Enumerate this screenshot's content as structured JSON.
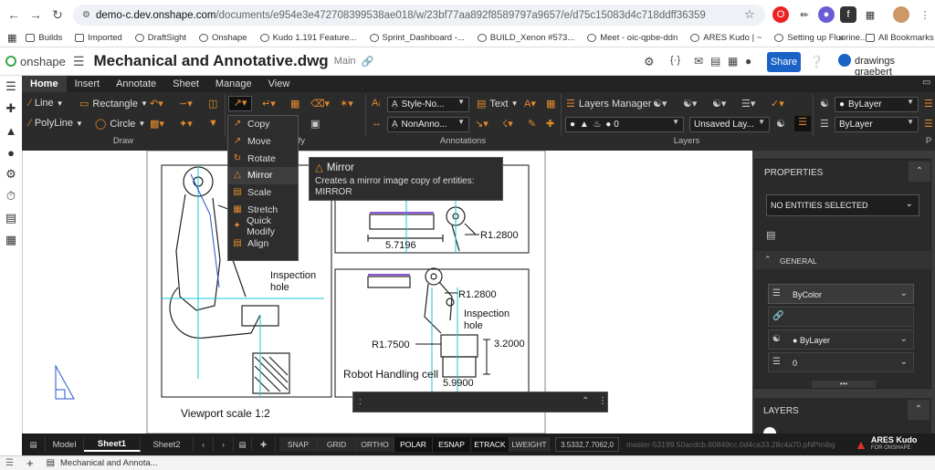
{
  "browser": {
    "url_host": "demo-c.dev.onshape.com",
    "url_path": "/documents/e954e3e472708399538ae018/w/23bf77aa892f8589797a9657/e/d75c15083d4c718ddff36359",
    "bookmarks": [
      "Builds",
      "Imported",
      "DraftSight",
      "Onshape",
      "Kudo 1.191 Feature...",
      "Sprint_Dashboard -...",
      "BUILD_Xenon #573...",
      "Meet - oic-qpbe-ddn",
      "ARES Kudo | ~",
      "Setting up Fluorine..."
    ],
    "all_bookmarks": "All Bookmarks"
  },
  "header": {
    "logo": "onshape",
    "title": "Mechanical and Annotative.dwg",
    "branch": "Main",
    "share_label": "Share",
    "user": "drawings graebert"
  },
  "ribbon": {
    "tabs": [
      "Home",
      "Insert",
      "Annotate",
      "Sheet",
      "Manage",
      "View"
    ],
    "active_tab": "Home",
    "groups": {
      "draw": "Draw",
      "modify": "Modify",
      "annotations": "Annotations",
      "layers": "Layers",
      "properties": "P"
    },
    "draw": {
      "line": "Line",
      "rectangle": "Rectangle",
      "polyline": "PolyLine",
      "circle": "Circle"
    },
    "annotations": {
      "text_style": "Style-No...",
      "dim_style": "NonAnno...",
      "text": "Text"
    },
    "layers": {
      "manager": "Layers Manager",
      "current_layer": "0",
      "layer_state": "Unsaved Lay..."
    },
    "properties": {
      "color": "ByLayer",
      "linetype": "ByLayer"
    }
  },
  "modify_menu": {
    "items": [
      "Copy",
      "Move",
      "Rotate",
      "Mirror",
      "Scale",
      "Stretch",
      "Quick Modify",
      "Align"
    ],
    "highlighted": "Mirror"
  },
  "tooltip": {
    "title": "Mirror",
    "description": "Creates a mirror image copy of entities:",
    "command": "MIRROR"
  },
  "drawing": {
    "dim1": "5.7196",
    "radius1": "R1.2800",
    "inspection_hole": "Inspection hole",
    "radius2": "R1.2800",
    "radius3": "R1.7500",
    "dim2": "3.2000",
    "dim3": "5.9900",
    "cell_label": "Robot Handling cell",
    "viewport_label": "Viewport scale 1:2",
    "inspection_hole2": "Inspection hole"
  },
  "properties_panel": {
    "title": "PROPERTIES",
    "selection": "NO ENTITIES SELECTED",
    "section": "GENERAL",
    "color": "ByColor",
    "layer": "ByLayer",
    "linetype": "0"
  },
  "layers_panel": {
    "title": "LAYERS"
  },
  "command_line": {
    "prompt": ":"
  },
  "status_bar": {
    "tabs": [
      "Model",
      "Sheet1",
      "Sheet2"
    ],
    "active_tab": "Sheet1",
    "toggles": [
      "SNAP",
      "GRID",
      "ORTHO",
      "POLAR",
      "ESNAP",
      "ETRACK",
      "LWEIGHT"
    ],
    "coords": "3.5332,7.7062,0",
    "version": "master-53199.50acdcb.60849cc.0d4ca33.28c4a70.pNPmibg",
    "brand": "ARES Kudo",
    "brand_sub": "FOR ONSHAPE"
  },
  "bottom_tab": {
    "label": "Mechanical and Annota..."
  }
}
